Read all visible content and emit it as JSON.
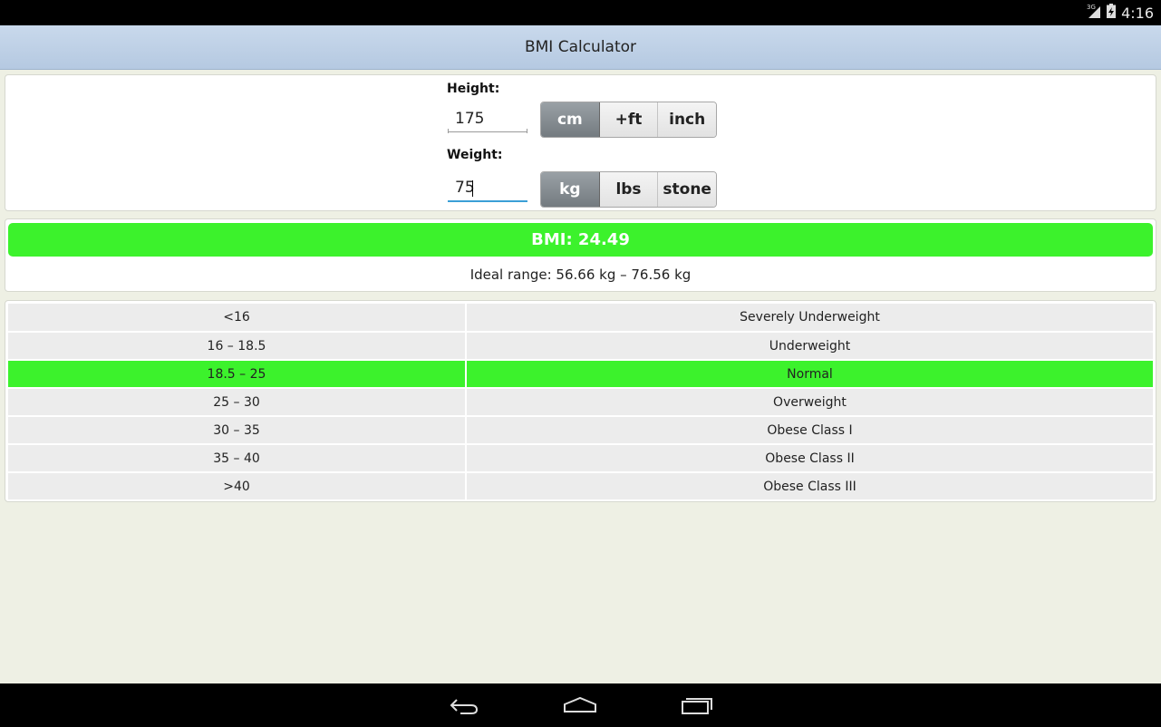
{
  "status_bar": {
    "network": "3G",
    "time": "4:16"
  },
  "app": {
    "title": "BMI Calculator"
  },
  "height": {
    "label": "Height:",
    "value": "175",
    "units": [
      "cm",
      "+ft",
      "inch"
    ],
    "selected_unit": "cm"
  },
  "weight": {
    "label": "Weight:",
    "value": "75",
    "units": [
      "kg",
      "lbs",
      "stone"
    ],
    "selected_unit": "kg"
  },
  "result": {
    "bmi_text": "BMI: 24.49",
    "ideal_range_text": "Ideal range: 56.66 kg – 76.56 kg"
  },
  "categories": [
    {
      "range": "<16",
      "label": "Severely Underweight"
    },
    {
      "range": "16 – 18.5",
      "label": "Underweight"
    },
    {
      "range": "18.5 – 25",
      "label": "Normal"
    },
    {
      "range": "25 – 30",
      "label": "Overweight"
    },
    {
      "range": "30 – 35",
      "label": "Obese Class I"
    },
    {
      "range": "35 – 40",
      "label": "Obese Class II"
    },
    {
      "range": ">40",
      "label": "Obese Class III"
    }
  ],
  "highlighted_category": 2,
  "colors": {
    "accent": "#3cf22c",
    "input_focus": "#3b9fd6",
    "action_bar": "#c0d2e8"
  }
}
